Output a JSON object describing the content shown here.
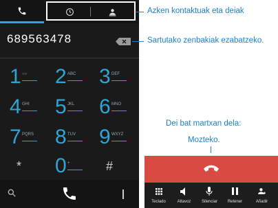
{
  "dialer": {
    "number": "689563478",
    "keys": [
      {
        "digit": "1",
        "letters": "○○"
      },
      {
        "digit": "2",
        "letters": "ABC"
      },
      {
        "digit": "3",
        "letters": "DEF"
      },
      {
        "digit": "4",
        "letters": "GHI"
      },
      {
        "digit": "5",
        "letters": "JKL"
      },
      {
        "digit": "6",
        "letters": "MNO"
      },
      {
        "digit": "7",
        "letters": "PQRS"
      },
      {
        "digit": "8",
        "letters": "TUV"
      },
      {
        "digit": "9",
        "letters": "WXYZ"
      },
      {
        "digit": "*",
        "letters": ""
      },
      {
        "digit": "0",
        "letters": "+"
      },
      {
        "digit": "#",
        "letters": ""
      }
    ]
  },
  "annotations": {
    "contacts": "Azken kontaktuak eta deiak",
    "delete": "Sartutako zenbakiak ezabatzeko.",
    "call_line1": "Dei bat martxan dela:",
    "call_line2": "Mozteko."
  },
  "incall": {
    "buttons": [
      {
        "label": "Teclado"
      },
      {
        "label": "Altavoz"
      },
      {
        "label": "Silenciar"
      },
      {
        "label": "Retener"
      },
      {
        "label": "Añadir"
      }
    ]
  },
  "colors": {
    "accent": "#2fa5d6",
    "annotation": "#1e7fc7",
    "end_call": "#d94a43"
  }
}
